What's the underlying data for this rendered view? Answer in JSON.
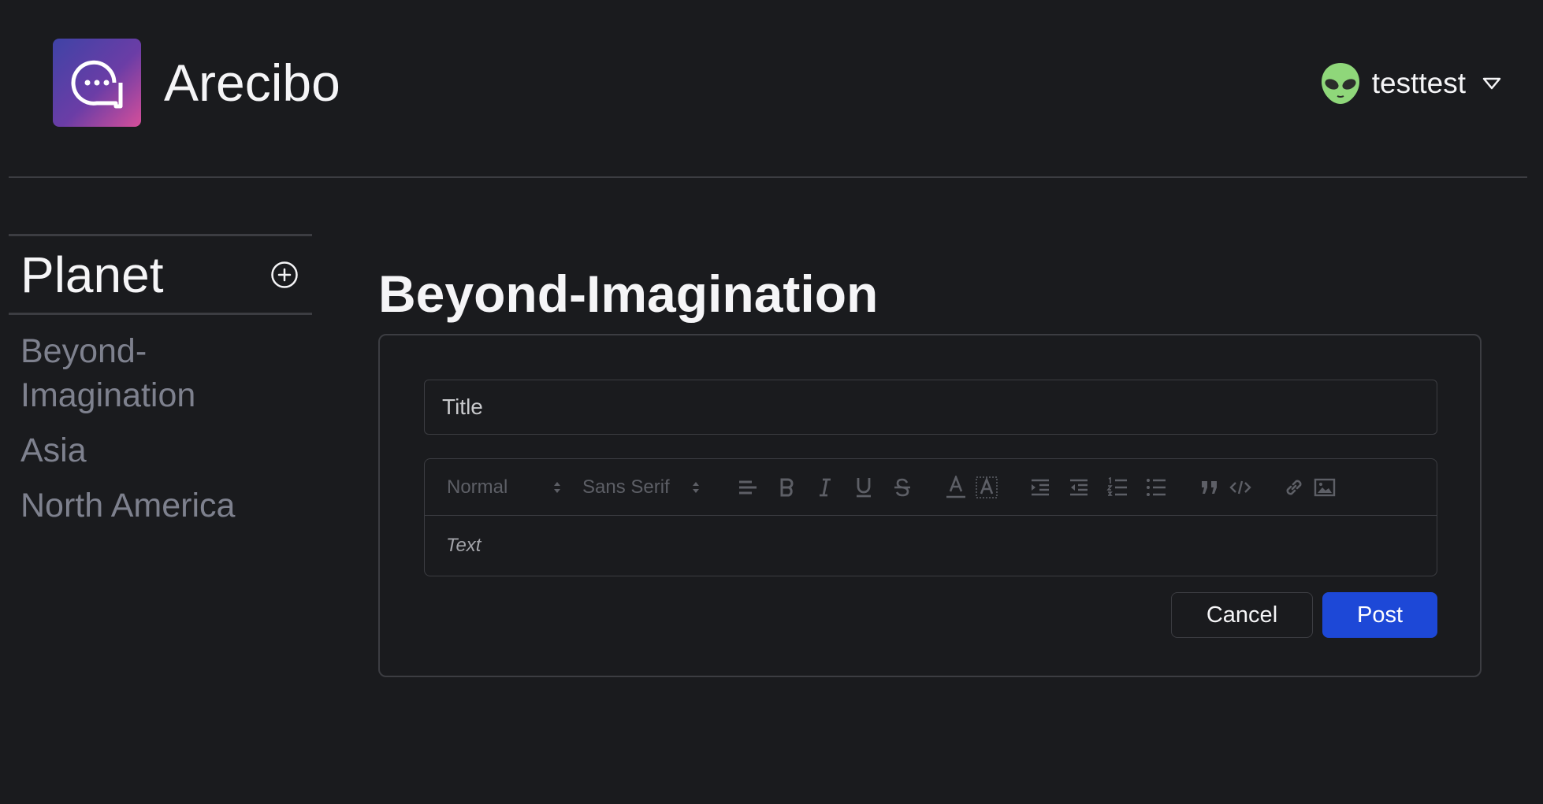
{
  "app": {
    "name": "Arecibo",
    "brand_colors": [
      "#3f43a6",
      "#d64f9a"
    ]
  },
  "user": {
    "name": "testtest",
    "avatar_icon": "alien-emoji"
  },
  "sidebar": {
    "title": "Planet",
    "add_icon": "plus-circle-icon",
    "items": [
      {
        "label": "Beyond-Imagination"
      },
      {
        "label": "Asia"
      },
      {
        "label": "North America"
      }
    ]
  },
  "main": {
    "title": "Beyond-Imagination",
    "form": {
      "title_placeholder": "Title",
      "body_placeholder": "Text",
      "toolbar": {
        "heading_select": "Normal",
        "font_select": "Sans Serif",
        "buttons": [
          "align-left-icon",
          "bold-icon",
          "italic-icon",
          "underline-icon",
          "strike-icon",
          "text-color-icon",
          "background-color-icon",
          "indent-icon",
          "outdent-icon",
          "ordered-list-icon",
          "bullet-list-icon",
          "blockquote-icon",
          "code-block-icon",
          "link-icon",
          "image-icon"
        ]
      },
      "cancel_label": "Cancel",
      "post_label": "Post"
    }
  },
  "colors": {
    "background": "#1a1b1e",
    "border": "#3c3d42",
    "primary": "#1d48d7",
    "muted_text": "#7e818e"
  }
}
